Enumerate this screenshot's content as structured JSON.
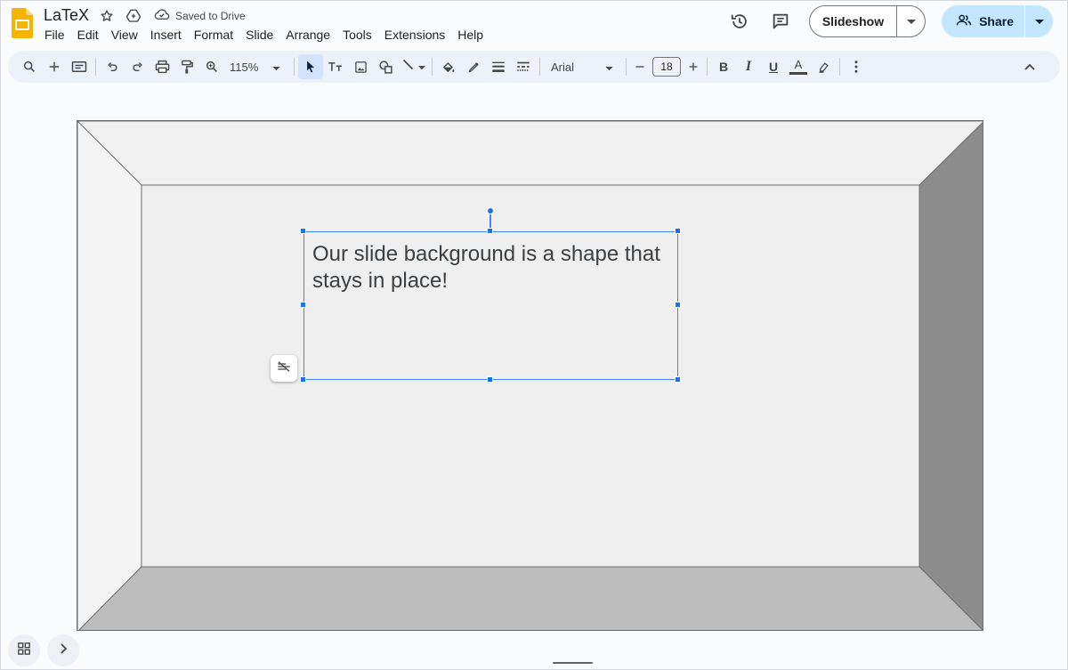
{
  "header": {
    "doc_title": "LaTeX",
    "saved_status": "Saved to Drive",
    "menu": [
      "File",
      "Edit",
      "View",
      "Insert",
      "Format",
      "Slide",
      "Arrange",
      "Tools",
      "Extensions",
      "Help"
    ],
    "slideshow_label": "Slideshow",
    "share_label": "Share"
  },
  "toolbar": {
    "zoom": "115%",
    "font": "Arial",
    "font_size": "18",
    "bold": "B",
    "italic": "I",
    "underline": "U",
    "text_color_glyph": "A"
  },
  "slide": {
    "text": "Our slide background is a shape that stays in place!"
  },
  "colors": {
    "accent": "#1a73e8",
    "share_bg": "#c2e7ff",
    "toolbar_bg": "#edf2fa",
    "slide_top_panel": "#f0f0f0",
    "slide_left_panel": "#f4f4f4",
    "slide_right_panel": "#8c8c8c",
    "slide_bottom_panel": "#bdbdbd",
    "slide_inner": "#efefef"
  }
}
